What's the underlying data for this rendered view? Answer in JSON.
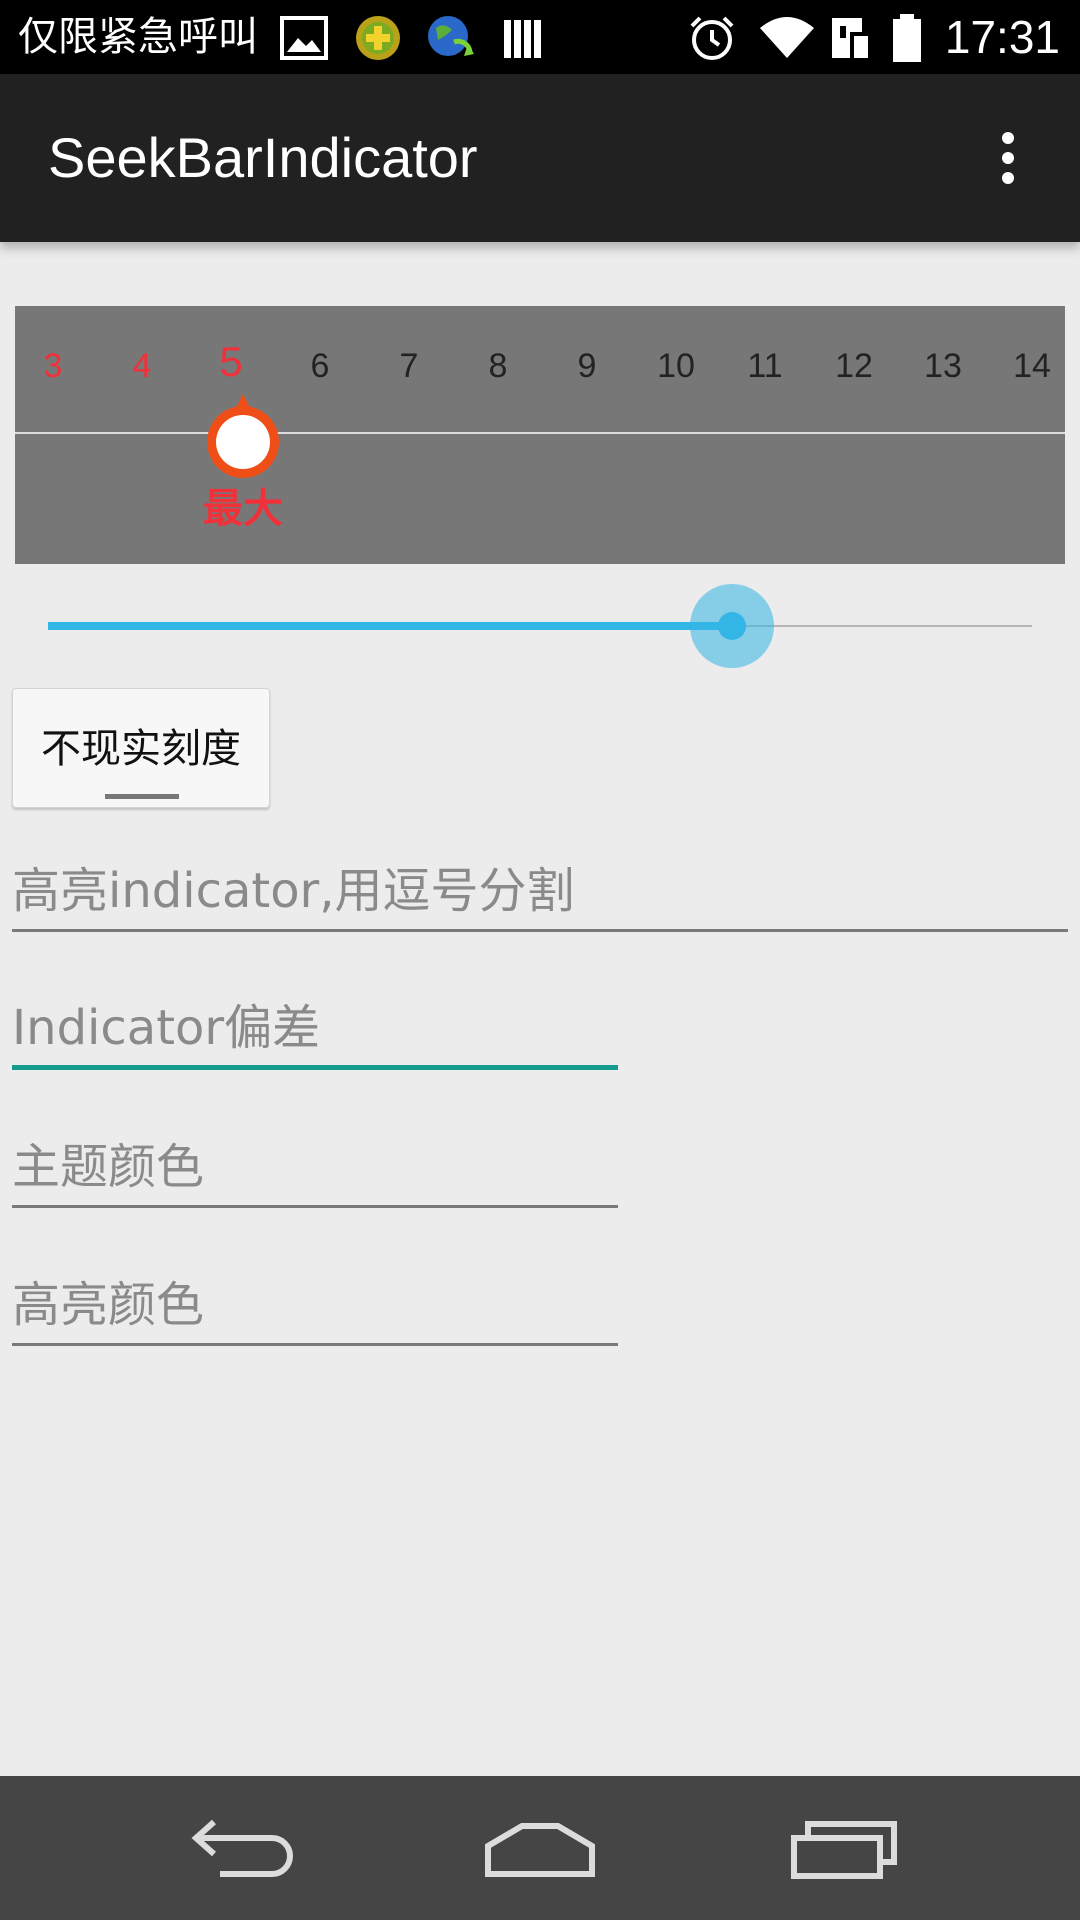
{
  "status_bar": {
    "carrier_text": "仅限紧急呼叫",
    "time": "17:31",
    "left_icons": [
      "gallery-icon",
      "game-badge-icon",
      "globe-sync-icon",
      "barcode-icon"
    ],
    "right_icons": [
      "alarm-icon",
      "wifi-icon",
      "sim-icon",
      "battery-icon"
    ]
  },
  "app_bar": {
    "title": "SeekBarIndicator",
    "menu_icon": "overflow-menu-icon"
  },
  "indicator": {
    "ticks": [
      "3",
      "4",
      "5",
      "6",
      "7",
      "8",
      "9",
      "10",
      "11",
      "12",
      "13",
      "14"
    ],
    "highlighted": [
      "3",
      "4",
      "5"
    ],
    "current": "5",
    "marker_label": "最大",
    "highlight_color": "#f0313a",
    "marker_color": "#f04e17",
    "panel_color": "#777777"
  },
  "seekbar": {
    "progress": 0.6951,
    "accent": "#33b5e5"
  },
  "toggle_scale_button": {
    "label": "不现实刻度"
  },
  "fields": {
    "highlight_indicators": {
      "placeholder": "高亮indicator,用逗号分割",
      "value": ""
    },
    "indicator_offset": {
      "placeholder": "Indicator偏差",
      "value": ""
    },
    "theme_color": {
      "placeholder": "主题颜色",
      "value": ""
    },
    "highlight_color": {
      "placeholder": "高亮颜色",
      "value": ""
    },
    "focus_color": "#159b8e"
  },
  "nav_bar": {
    "back_icon": "back-icon",
    "home_icon": "home-icon",
    "recents_icon": "recents-icon"
  }
}
